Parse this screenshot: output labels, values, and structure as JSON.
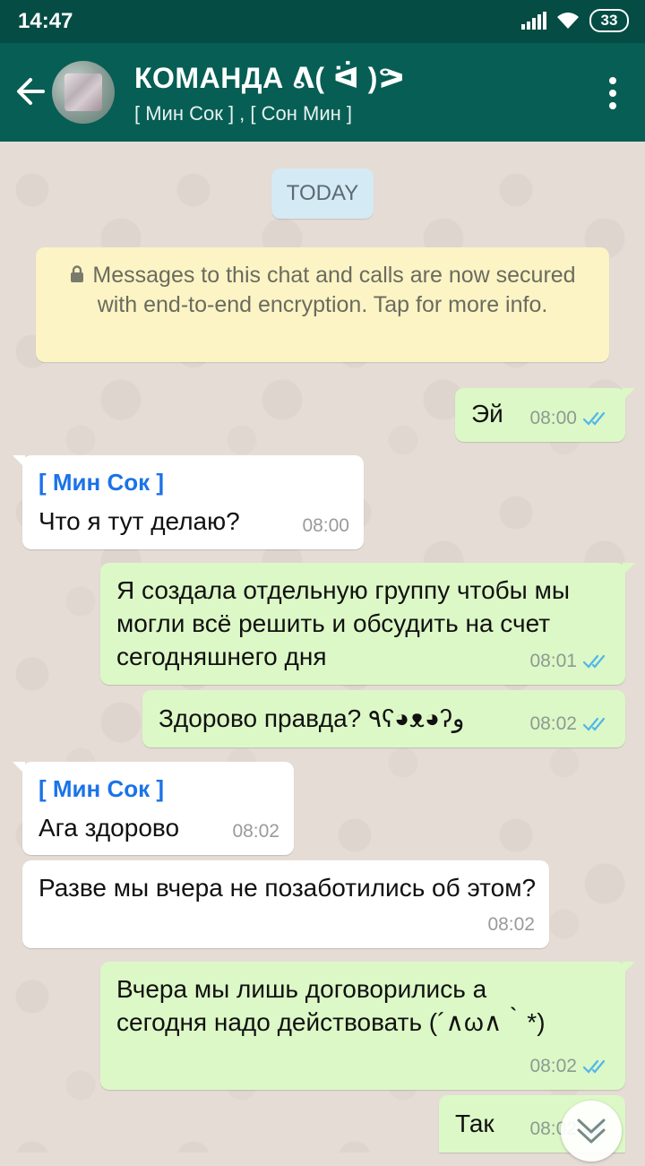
{
  "status_bar": {
    "time": "14:47",
    "battery": "33",
    "icons": [
      "signal-icon",
      "wifi-icon",
      "battery-icon"
    ]
  },
  "header": {
    "title": "КОМАНДА ᕕ( ᐛ )ᕗ",
    "subtitle": "[ Мин Сок ] , [ Сон Мин ]"
  },
  "chat": {
    "date_chip": "TODAY",
    "encryption_notice": "Messages to this chat and calls are now secured with end-to-end encryption. Tap for more info.",
    "messages": [
      {
        "direction": "out",
        "text": "Эй",
        "time": "08:00",
        "status": "read"
      },
      {
        "direction": "in",
        "sender": "[ Мин Сок ]",
        "text": "Что я тут делаю?",
        "time": "08:00"
      },
      {
        "direction": "out",
        "text": "Я создала отдельную группу чтобы мы могли всё решить и обсудить на счет сегодняшнего дня",
        "time": "08:01",
        "status": "read"
      },
      {
        "direction": "out",
        "text": "Здорово правда? ٩ʕ◕ᴥ◕ʔو",
        "time": "08:02",
        "status": "read"
      },
      {
        "direction": "in",
        "sender": "[ Мин Сок ]",
        "text": "Ага здорово",
        "time": "08:02"
      },
      {
        "direction": "in",
        "text": "Разве мы вчера не позаботились об этом?",
        "time": "08:02"
      },
      {
        "direction": "out",
        "text": "Вчера мы лишь договорились а сегодня надо действовать (´∧ω∧｀*)",
        "time": "08:02",
        "status": "read"
      },
      {
        "direction": "out",
        "text": "Так",
        "time": "08:02",
        "status": "read"
      }
    ]
  },
  "colors": {
    "header": "#075e54",
    "status_bar": "#054c44",
    "outgoing_bubble": "#dcf8c6",
    "incoming_bubble": "#ffffff",
    "sender_name": "#1a73e8",
    "read_ticks": "#4fb6ec"
  }
}
